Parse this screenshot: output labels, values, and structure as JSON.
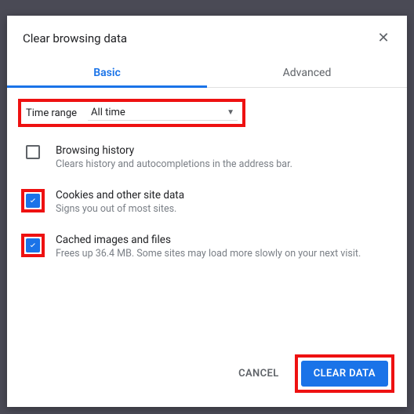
{
  "dialog": {
    "title": "Clear browsing data",
    "tabs": {
      "basic": "Basic",
      "advanced": "Advanced",
      "active": "basic"
    },
    "range": {
      "label": "Time range",
      "value": "All time"
    },
    "options": [
      {
        "title": "Browsing history",
        "desc": "Clears history and autocompletions in the address bar.",
        "checked": false,
        "highlight": false
      },
      {
        "title": "Cookies and other site data",
        "desc": "Signs you out of most sites.",
        "checked": true,
        "highlight": true
      },
      {
        "title": "Cached images and files",
        "desc": "Frees up 36.4 MB. Some sites may load more slowly on your next visit.",
        "checked": true,
        "highlight": true
      }
    ],
    "buttons": {
      "cancel": "CANCEL",
      "clear": "CLEAR DATA"
    }
  },
  "colors": {
    "accent": "#1a73e8",
    "highlight": "#e11"
  }
}
